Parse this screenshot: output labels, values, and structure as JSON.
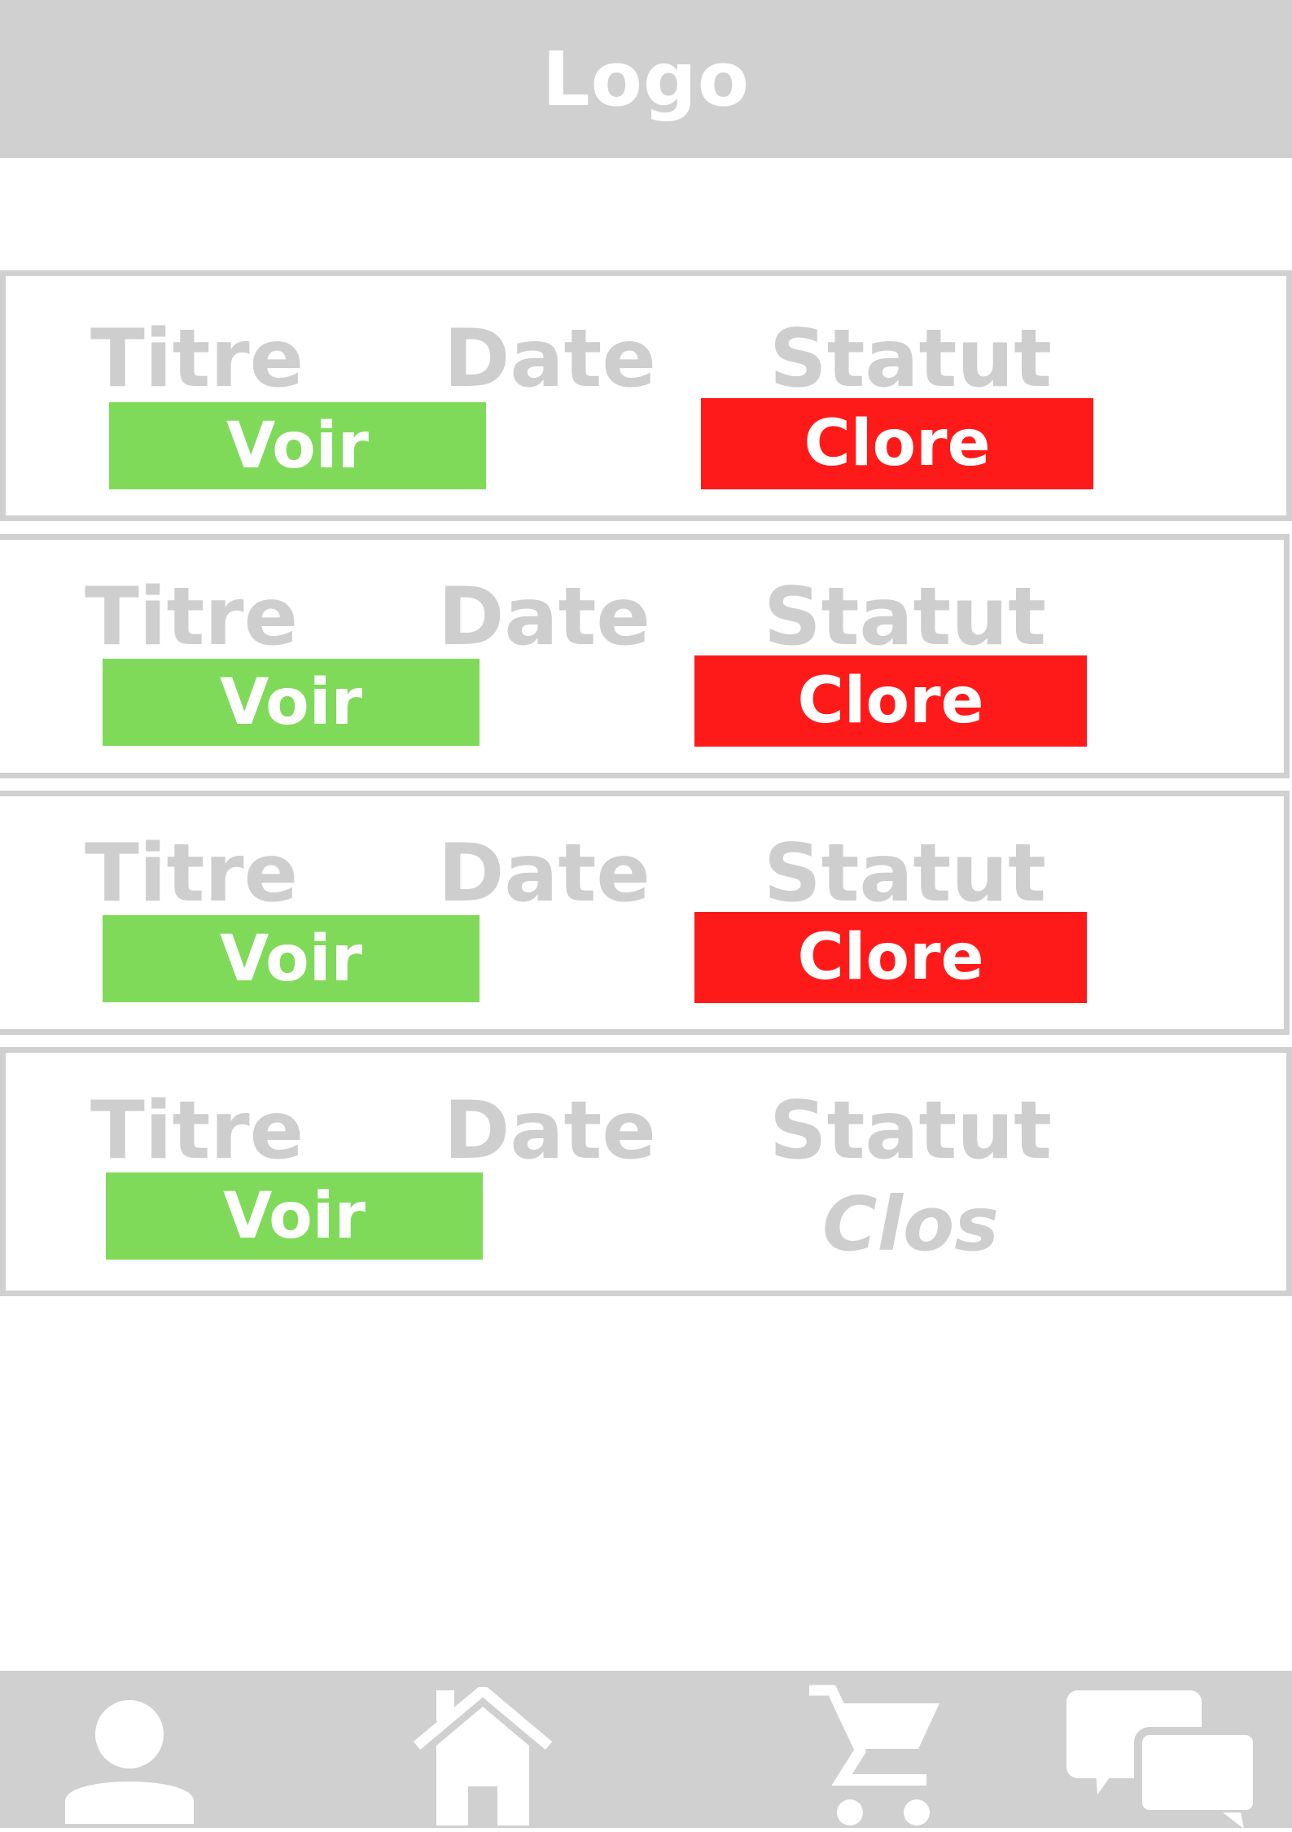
{
  "header": {
    "logo": "Logo"
  },
  "rows": [
    {
      "title": "Titre",
      "date": "Date",
      "status": "Statut",
      "view": "Voir",
      "close": "Clore"
    },
    {
      "title": "Titre",
      "date": "Date",
      "status": "Statut",
      "view": "Voir",
      "close": "Clore"
    },
    {
      "title": "Titre",
      "date": "Date",
      "status": "Statut",
      "view": "Voir",
      "close": "Clore"
    },
    {
      "title": "Titre",
      "date": "Date",
      "status": "Statut",
      "view": "Voir",
      "closed": "Clos"
    }
  ],
  "nav": {
    "items": [
      {
        "icon": "user-icon"
      },
      {
        "icon": "home-icon"
      },
      {
        "icon": "cart-icon"
      },
      {
        "icon": "chat-icon"
      }
    ]
  },
  "colors": {
    "bar": "#d0d0d0",
    "label": "#cecece",
    "view_button": "#80da5a",
    "close_button": "#ff1a1a"
  }
}
